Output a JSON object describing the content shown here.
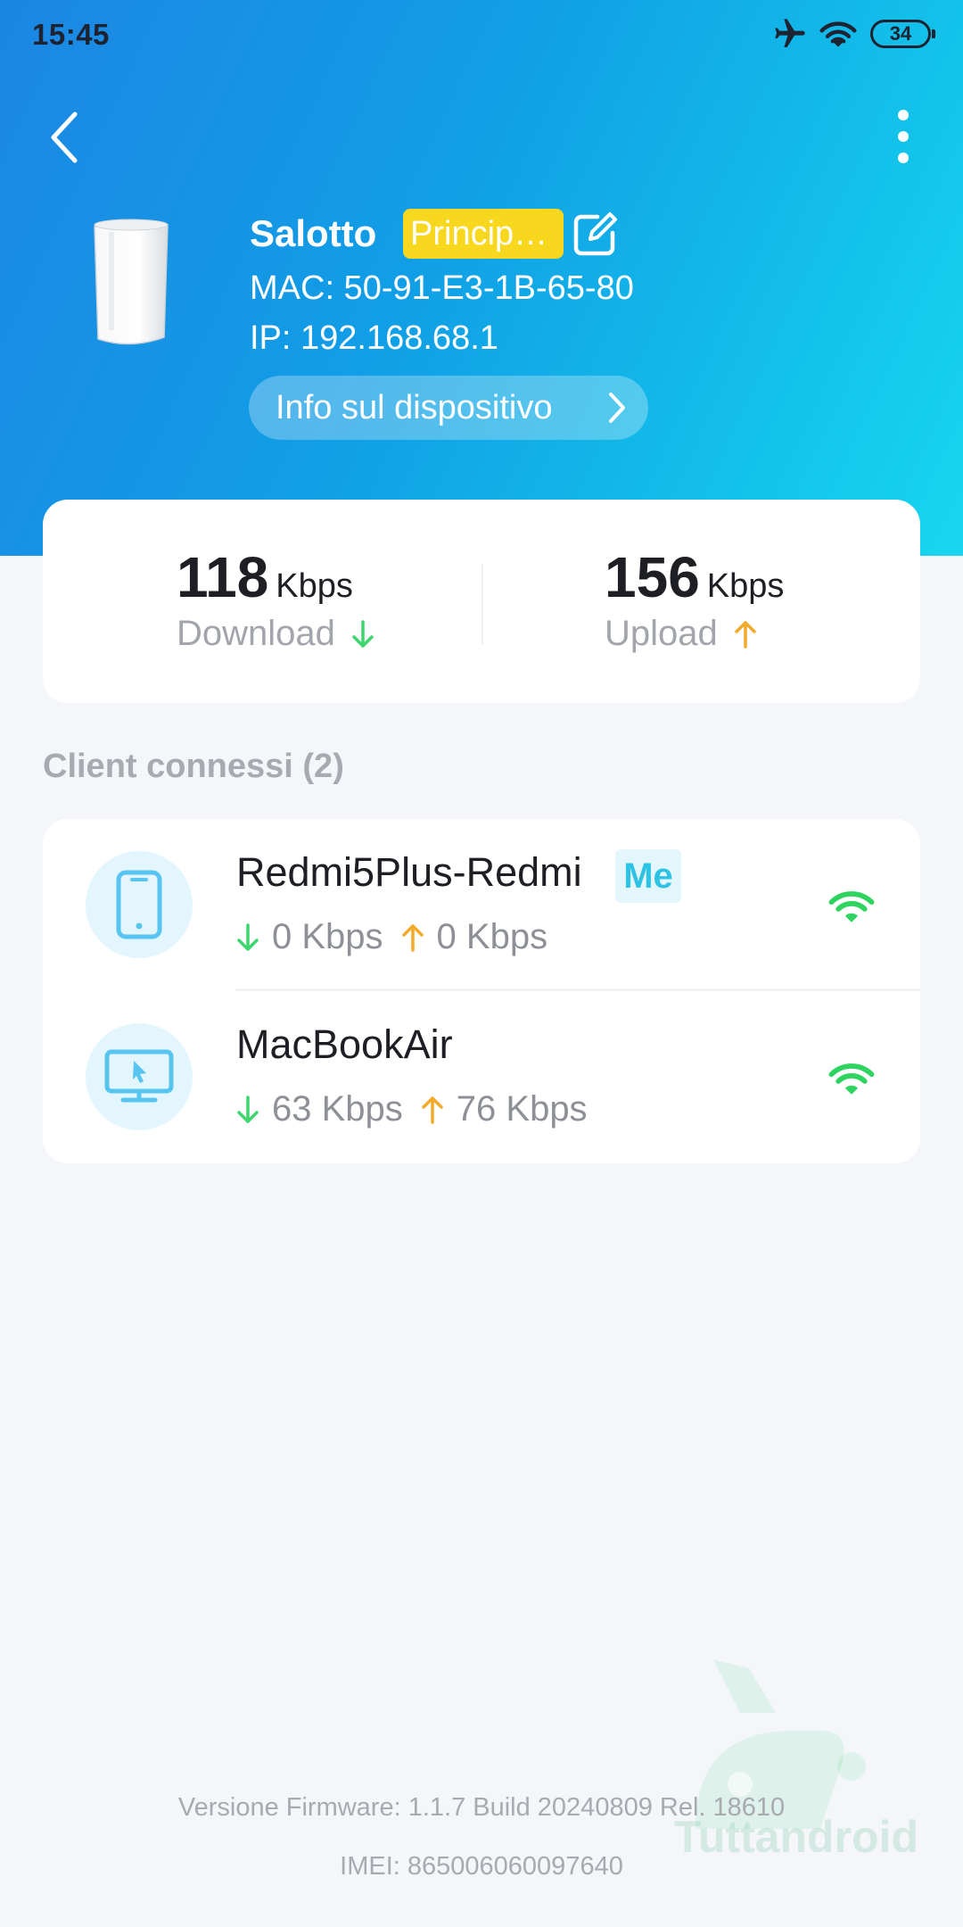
{
  "status_bar": {
    "time": "15:45",
    "battery": "34",
    "icons": [
      "airplane-icon",
      "wifi-icon",
      "battery-icon"
    ]
  },
  "nav": {
    "back_icon": "chevron-left-icon",
    "more_icon": "more-vertical-icon"
  },
  "device": {
    "name": "Salotto",
    "badge": "Princip…",
    "mac": "MAC: 50-91-E3-1B-65-80",
    "ip": "IP: 192.168.68.1",
    "info_button": "Info sul dispositivo"
  },
  "speed": {
    "download_value": "118",
    "download_unit": "Kbps",
    "download_label": "Download",
    "upload_value": "156",
    "upload_unit": "Kbps",
    "upload_label": "Upload"
  },
  "clients": {
    "title": "Client connessi (2)",
    "items": [
      {
        "name": "Redmi5Plus-Redmi",
        "badge": "Me",
        "down": "0 Kbps",
        "up": "0 Kbps",
        "icon": "phone-icon"
      },
      {
        "name": "MacBookAir",
        "down": "63 Kbps",
        "up": "76 Kbps",
        "icon": "monitor-icon"
      }
    ]
  },
  "footer": {
    "firmware": "Versione Firmware: 1.1.7 Build 20240809 Rel. 18610",
    "imei": "IMEI: 865006060097640"
  },
  "watermark": "Tuttandroid",
  "colors": {
    "header_start": "#1c86e3",
    "header_end": "#19d6ef",
    "badge_yellow": "#f8d81f",
    "download_green": "#3dd56d",
    "upload_orange": "#f3a92a",
    "wifi_green": "#2fd35f"
  }
}
